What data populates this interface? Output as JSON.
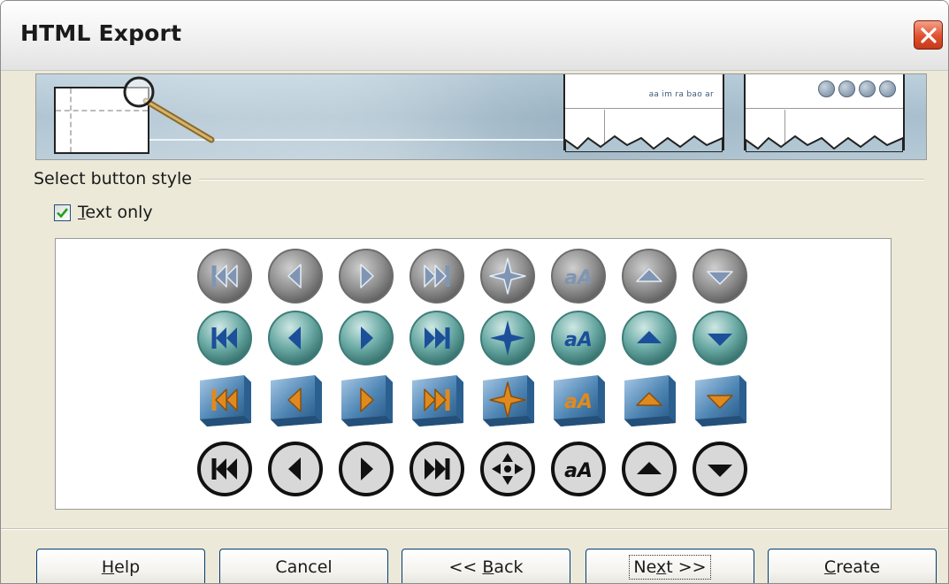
{
  "window": {
    "title": "HTML Export"
  },
  "banner": {
    "nav_text": "aa im ra bao ar"
  },
  "section": {
    "label": "Select button style"
  },
  "text_only": {
    "label": "Text only",
    "checked": true
  },
  "button_styles": [
    {
      "name": "grey-round",
      "icons": [
        "first-icon",
        "previous-icon",
        "next-icon",
        "last-icon",
        "navigation-icon",
        "text-size-icon",
        "up-icon",
        "down-icon"
      ]
    },
    {
      "name": "teal-round",
      "icons": [
        "first-icon",
        "previous-icon",
        "next-icon",
        "last-icon",
        "navigation-icon",
        "text-size-icon",
        "up-icon",
        "down-icon"
      ]
    },
    {
      "name": "blue-cube",
      "icons": [
        "first-icon",
        "previous-icon",
        "next-icon",
        "last-icon",
        "navigation-icon",
        "text-size-icon",
        "up-icon",
        "down-icon"
      ]
    },
    {
      "name": "black-outline",
      "icons": [
        "first-icon",
        "previous-icon",
        "next-icon",
        "last-icon",
        "navigation-icon",
        "text-size-icon",
        "up-icon",
        "down-icon"
      ]
    }
  ],
  "buttons": {
    "help": "Help",
    "cancel": "Cancel",
    "back": "<< Back",
    "next": "Next >>",
    "create": "Create"
  },
  "colors": {
    "title_bar_close": "#e0502e",
    "grey_button": "#8d8d8d",
    "teal_button": "#6aa9a4",
    "cube_blue": "#4f86b4",
    "cube_glyph": "#e08a1e"
  }
}
